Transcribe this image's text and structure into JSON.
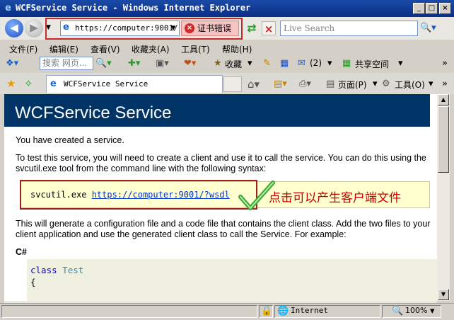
{
  "window": {
    "title": "WCFService Service - Windows Internet Explorer",
    "minimize": "_",
    "maximize": "□",
    "close": "×"
  },
  "address": {
    "url": "https://computer:9001/",
    "cert_error": "证书错误"
  },
  "search": {
    "placeholder": "Live Search"
  },
  "menu": [
    "文件(F)",
    "编辑(E)",
    "查看(V)",
    "收藏夹(A)",
    "工具(T)",
    "帮助(H)"
  ],
  "toolbar2": {
    "search_placeholder": "搜索 网页...",
    "favorites": "收藏",
    "count": "(2)",
    "share": "共享空间"
  },
  "tab": {
    "title": "WCFService Service"
  },
  "command_bar": {
    "page": "页面(P)",
    "tools": "工具(O)"
  },
  "content": {
    "heading": "WCFService Service",
    "p1": "You have created a service.",
    "p2": "To test this service, you will need to create a client and use it to call the service. You can do this using the svcutil.exe tool from the command line with the following syntax:",
    "svcutil_cmd": "svcutil.exe ",
    "svcutil_link": "https://computer:9001/?wsdl",
    "annotation": "点击可以产生客户端文件",
    "p3": "This will generate a configuration file and a code file that contains the client class. Add the two files to your client application and use the generated client class to call the Service. For example:",
    "lang": "C#",
    "code_kw": "class",
    "code_cls": "Test",
    "code_brace": "{"
  },
  "status": {
    "zone": "Internet",
    "zoom": "100%"
  },
  "colors": {
    "banner": "#003366",
    "annotation": "#c40000",
    "highlight_border": "#c82828",
    "link": "#0033cc"
  }
}
